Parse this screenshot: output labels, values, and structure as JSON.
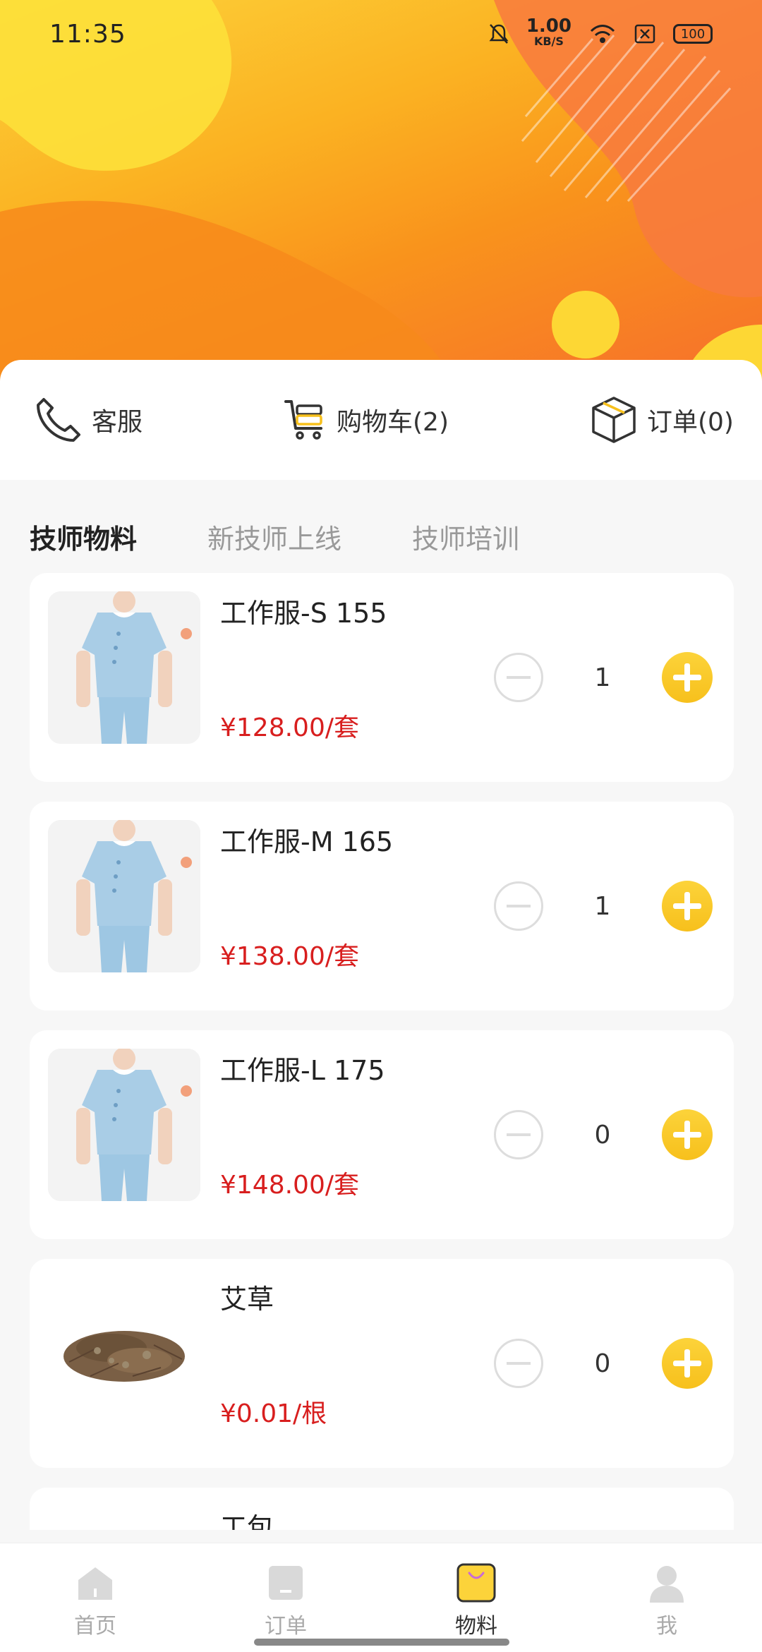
{
  "status_bar": {
    "time": "11:35",
    "speed_value": "1.00",
    "speed_unit": "KB/S",
    "battery": "100"
  },
  "quick_actions": {
    "service_label": "客服",
    "cart_label": "购物车(2)",
    "orders_label": "订单(0)"
  },
  "tabs": [
    {
      "label": "技师物料",
      "active": true
    },
    {
      "label": "新技师上线",
      "active": false
    },
    {
      "label": "技师培训",
      "active": false
    }
  ],
  "products": [
    {
      "name": "工作服-S 155",
      "price": "¥128.00/套",
      "qty": "1",
      "image": "uniform"
    },
    {
      "name": "工作服-M 165",
      "price": "¥138.00/套",
      "qty": "1",
      "image": "uniform"
    },
    {
      "name": "工作服-L 175",
      "price": "¥148.00/套",
      "qty": "0",
      "image": "uniform"
    },
    {
      "name": "艾草",
      "price": "¥0.01/根",
      "qty": "0",
      "image": "herb"
    },
    {
      "name": "工包",
      "image": "bag"
    }
  ],
  "bottom_nav": [
    {
      "label": "首页",
      "icon": "home-icon",
      "active": false
    },
    {
      "label": "订单",
      "icon": "order-icon",
      "active": false
    },
    {
      "label": "物料",
      "icon": "materials-bag-icon",
      "active": true
    },
    {
      "label": "我",
      "icon": "user-icon",
      "active": false
    }
  ],
  "colors": {
    "accent": "#f7c01c",
    "price": "#d81e1e",
    "banner_start": "#fcd23a",
    "banner_end": "#f66e2c"
  }
}
